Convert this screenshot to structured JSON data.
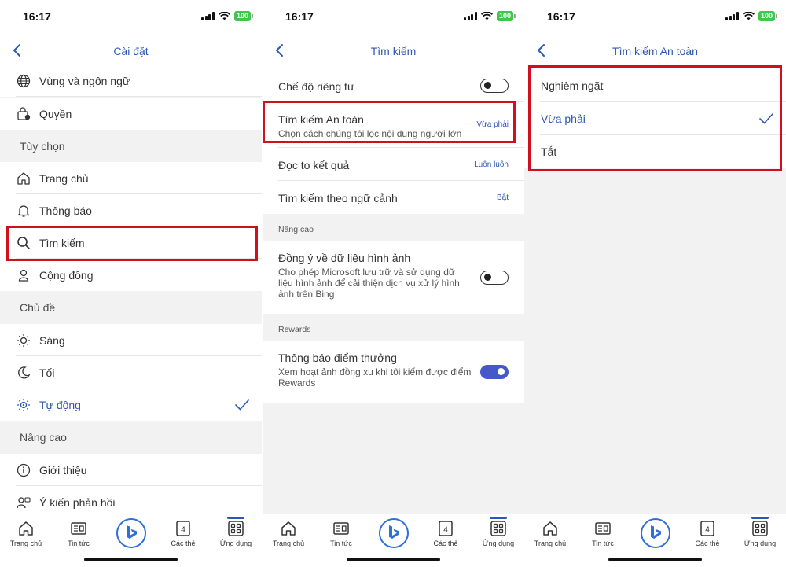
{
  "status": {
    "time": "16:17",
    "battery": "100"
  },
  "panel1": {
    "title": "Cài đặt",
    "rows": {
      "region": "Vùng và ngôn ngữ",
      "permissions": "Quyền",
      "home": "Trang chủ",
      "notifications": "Thông báo",
      "search": "Tìm kiếm",
      "community": "Cộng đồng",
      "light": "Sáng",
      "dark": "Tối",
      "auto": "Tự động",
      "about": "Giới thiệu",
      "feedback": "Ý kiến phản hồi"
    },
    "sections": {
      "options": "Tùy chọn",
      "theme": "Chủ đề",
      "advanced": "Nâng cao"
    },
    "selected_theme": "Tự động"
  },
  "panel2": {
    "title": "Tìm kiếm",
    "private_mode": {
      "label": "Chế độ riêng tư",
      "on": false
    },
    "safe_search": {
      "label": "Tìm kiếm An toàn",
      "desc": "Chọn cách chúng tôi lọc nội dung người lớn",
      "value": "Vừa phải"
    },
    "read_results": {
      "label": "Đọc to kết quả",
      "value": "Luôn luôn"
    },
    "contextual": {
      "label": "Tìm kiếm theo ngữ cảnh",
      "value": "Bật"
    },
    "advanced_header": "Nâng cao",
    "image_consent": {
      "label": "Đồng ý về dữ liệu hình ảnh",
      "desc_lines": [
        "Cho phép Microsoft lưu trữ và sử dụng dữ",
        "liệu hình ảnh để cải thiện dịch vụ xử lý hình",
        "ảnh trên Bing"
      ],
      "on": false
    },
    "rewards_header": "Rewards",
    "rewards_notify": {
      "label": "Thông báo điểm thưởng",
      "desc_lines": [
        "Xem hoạt ảnh đồng xu khi tôi kiếm được điểm",
        "Rewards"
      ],
      "on": true
    }
  },
  "panel3": {
    "title": "Tìm kiếm An toàn",
    "options": [
      "Nghiêm ngặt",
      "Vừa phải",
      "Tắt"
    ],
    "selected": "Vừa phải"
  },
  "tabbar": {
    "home": "Trang chủ",
    "news": "Tin tức",
    "tabs": "Các thẻ",
    "tabs_count": "4",
    "apps": "Ứng dụng"
  },
  "colors": {
    "accent": "#2b57b5",
    "highlight": "#d0101c",
    "toggle_on": "#4659c9"
  }
}
